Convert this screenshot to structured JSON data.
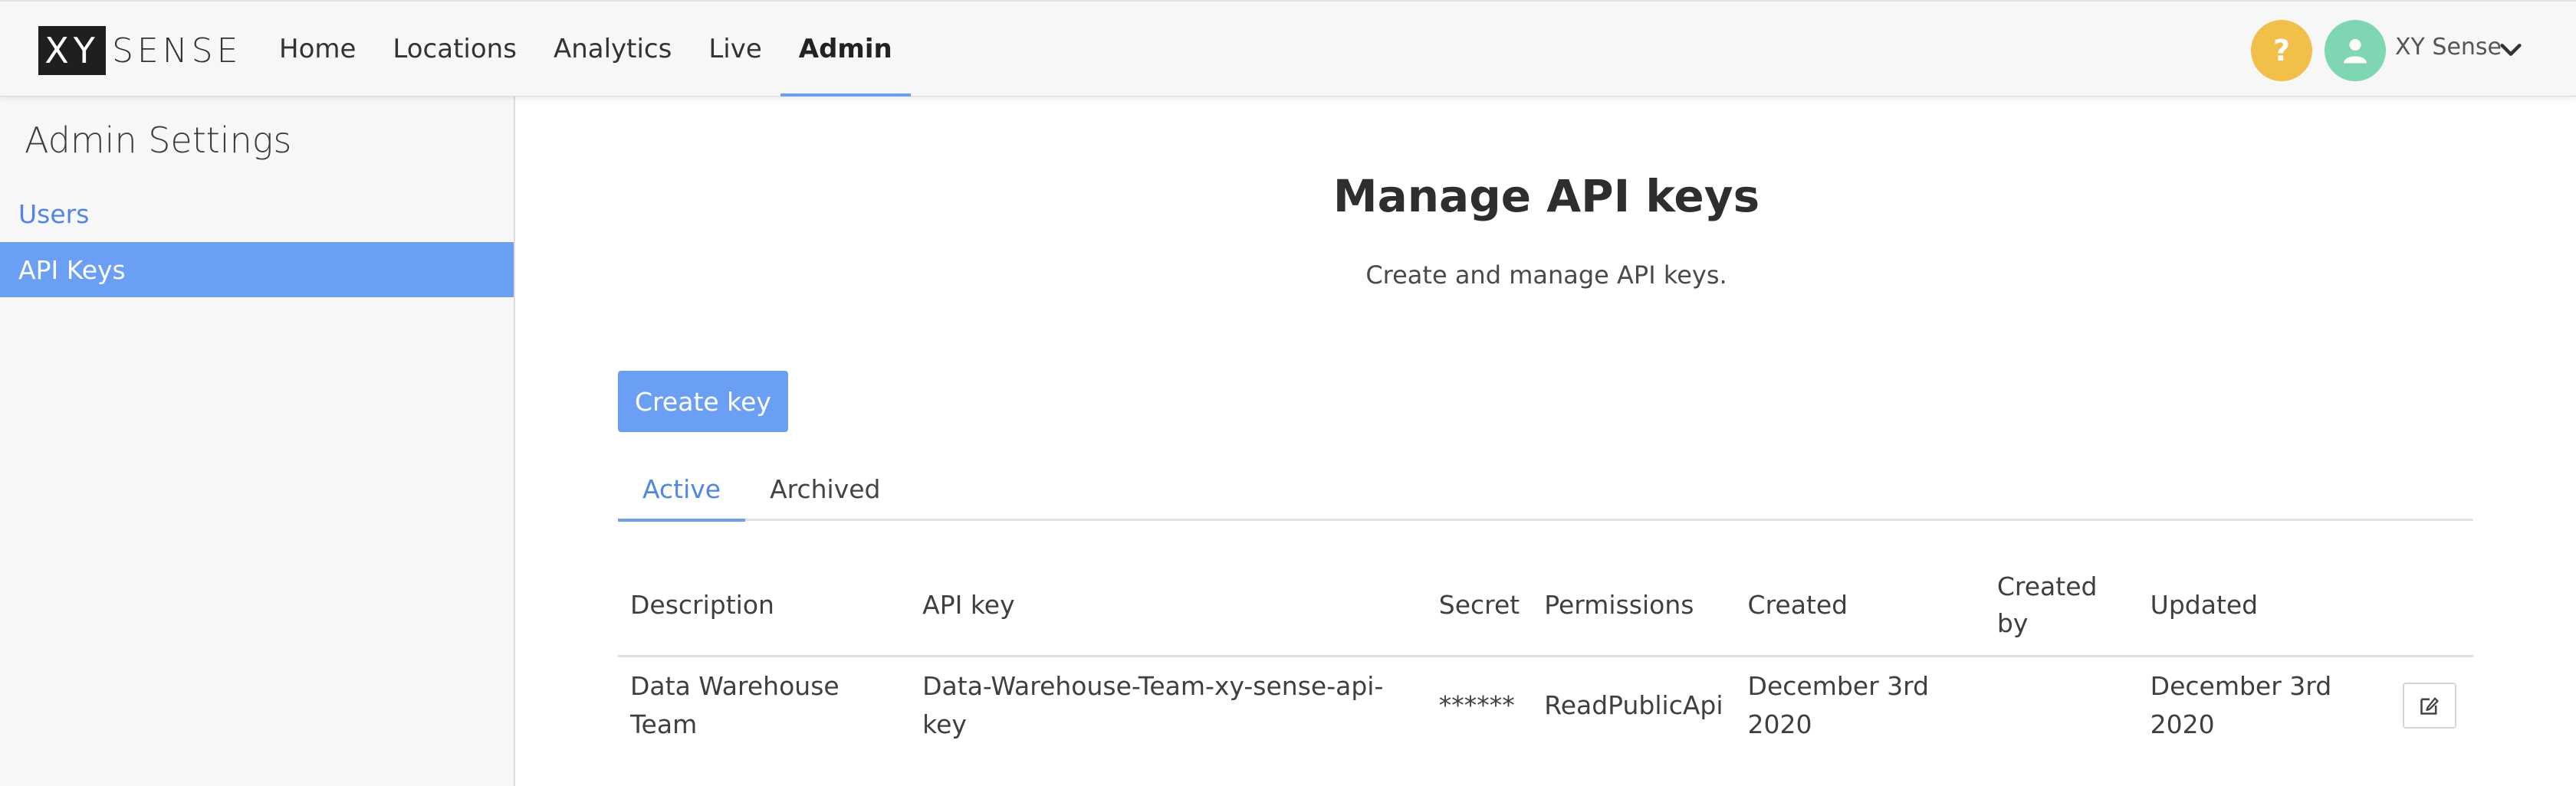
{
  "header": {
    "logo_box": "XY",
    "logo_text": "SENSE",
    "nav": [
      {
        "label": "Home",
        "active": false
      },
      {
        "label": "Locations",
        "active": false
      },
      {
        "label": "Analytics",
        "active": false
      },
      {
        "label": "Live",
        "active": false
      },
      {
        "label": "Admin",
        "active": true
      }
    ],
    "help_icon": "question-icon",
    "help_label": "?",
    "avatar_icon": "user-icon",
    "user_name": "XY Sense",
    "user_menu_icon": "chevron-down-icon"
  },
  "sidebar": {
    "title": "Admin Settings",
    "items": [
      {
        "label": "Users",
        "active": false
      },
      {
        "label": "API Keys",
        "active": true
      }
    ]
  },
  "main": {
    "title": "Manage API keys",
    "subtitle": "Create and manage API keys.",
    "create_button": "Create key",
    "tabs": [
      {
        "label": "Active",
        "active": true
      },
      {
        "label": "Archived",
        "active": false
      }
    ],
    "table": {
      "columns": [
        "Description",
        "API key",
        "Secret",
        "Permissions",
        "Created",
        "Created by",
        "Updated",
        ""
      ],
      "rows": [
        {
          "description": "Data Warehouse Team",
          "api_key": "Data-Warehouse-Team-xy-sense-api-key",
          "secret": "******",
          "permissions": "ReadPublicApi",
          "created": "December 3rd 2020",
          "created_by": "",
          "updated": "December 3rd 2020",
          "action_icon": "edit-icon"
        }
      ]
    }
  },
  "colors": {
    "accent": "#6b9ff5",
    "link": "#4f86e8",
    "help": "#f2c04a",
    "avatar": "#7fd6b3"
  }
}
